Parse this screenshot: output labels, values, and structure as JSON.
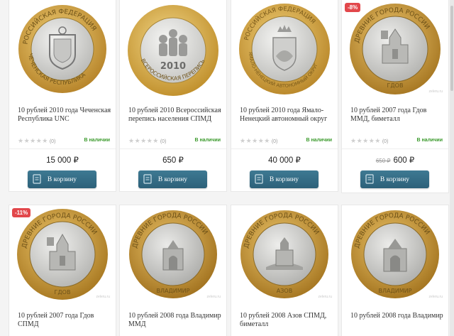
{
  "watermark": "zeleru.ru",
  "common": {
    "cart_label": "В корзину",
    "stock_label": "В наличии",
    "review_count": "(0)"
  },
  "products": [
    {
      "title": "10 рублей 2010 года Чеченская Республика UNC",
      "price": "15 000 ₽",
      "old_price": "",
      "discount": "",
      "coin": "chechnya",
      "legend": "РОССИЙСКАЯ ФЕДЕРАЦИЯ",
      "legend_bottom": "ЧЕЧЕНСКАЯ РЕСПУБЛИКА"
    },
    {
      "title": "10 рублей 2010 Всероссийская перепись населения СПМД",
      "price": "650 ₽",
      "old_price": "",
      "discount": "",
      "coin": "census",
      "legend": "ВСЕРОССИЙСКАЯ ПЕРЕПИСЬ",
      "legend_bottom": "2010"
    },
    {
      "title": "10 рублей 2010 года Ямало-Ненецкий автономный округ",
      "price": "40 000 ₽",
      "old_price": "",
      "discount": "",
      "coin": "yamal",
      "legend": "РОССИЙСКАЯ ФЕДЕРАЦИЯ",
      "legend_bottom": "ЯМАЛО-НЕНЕЦКИЙ АВТОНОМНЫЙ ОКРУГ"
    },
    {
      "title": "10 рублей 2007 года Гдов ММД, биметалл",
      "price": "600 ₽",
      "old_price": "650 ₽",
      "discount": "-8%",
      "coin": "gdov",
      "legend": "ДРЕВНИЕ ГОРОДА РОССИИ",
      "legend_bottom": "ГДОВ"
    },
    {
      "title": "10 рублей 2007 года Гдов СПМД",
      "price": "",
      "old_price": "",
      "discount": "-11%",
      "coin": "gdov2",
      "legend": "ДРЕВНИЕ ГОРОДА РОССИИ",
      "legend_bottom": "ГДОВ"
    },
    {
      "title": "10 рублей 2008 года Владимир ММД",
      "price": "",
      "old_price": "",
      "discount": "",
      "coin": "vladimir",
      "legend": "ДРЕВНИЕ ГОРОДА РОССИИ",
      "legend_bottom": "ВЛАДИМИР"
    },
    {
      "title": "10 рублей 2008 Азов СПМД, биметалл",
      "price": "",
      "old_price": "",
      "discount": "",
      "coin": "azov",
      "legend": "ДРЕВНИЕ ГОРОДА РОССИИ",
      "legend_bottom": "АЗОВ"
    },
    {
      "title": "10 рублей 2008 года Владимир",
      "price": "",
      "old_price": "",
      "discount": "",
      "coin": "vladimir2",
      "legend": "ДРЕВНИЕ ГОРОДА РОССИИ",
      "legend_bottom": "ВЛАДИМИР"
    }
  ],
  "colors": {
    "button": "#2d6179",
    "stock": "#3b9a2c",
    "badge": "#e2474b",
    "gold": "#d9a640",
    "silver": "#d8d8d6"
  }
}
